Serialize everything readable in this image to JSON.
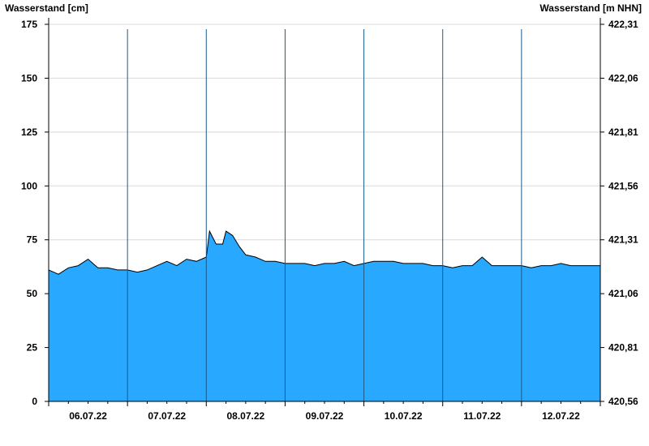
{
  "chart_data": {
    "type": "area",
    "ylabel_left": "Wasserstand [cm]",
    "ylabel_right": "Wasserstand [m NHN]",
    "ylim": [
      0,
      175
    ],
    "left_ticks": [
      "0",
      "25",
      "50",
      "75",
      "100",
      "125",
      "150",
      "175"
    ],
    "right_ticks": [
      "420,56",
      "420,81",
      "421,06",
      "421,31",
      "421,56",
      "421,81",
      "422,06",
      "422,31"
    ],
    "x_start": "06.07.22 00:00",
    "x_end": "13.07.22 00:00",
    "day_labels": [
      "06.07.22",
      "07.07.22",
      "08.07.22",
      "09.07.22",
      "10.07.22",
      "11.07.22",
      "12.07.22"
    ],
    "grid": true,
    "fill_color": "#29a8ff",
    "line_color": "#000000",
    "series": [
      {
        "x": [
          "06.07.22 00:00",
          "06.07.22 03:00",
          "06.07.22 06:00",
          "06.07.22 09:00",
          "06.07.22 12:00",
          "06.07.22 15:00",
          "06.07.22 18:00",
          "06.07.22 21:00",
          "07.07.22 00:00",
          "07.07.22 03:00",
          "07.07.22 06:00",
          "07.07.22 09:00",
          "07.07.22 12:00",
          "07.07.22 15:00",
          "07.07.22 18:00",
          "07.07.22 21:00",
          "08.07.22 00:00",
          "08.07.22 01:00",
          "08.07.22 03:00",
          "08.07.22 05:00",
          "08.07.22 06:00",
          "08.07.22 08:00",
          "08.07.22 10:00",
          "08.07.22 12:00",
          "08.07.22 15:00",
          "08.07.22 18:00",
          "08.07.22 21:00",
          "09.07.22 00:00",
          "09.07.22 03:00",
          "09.07.22 06:00",
          "09.07.22 09:00",
          "09.07.22 12:00",
          "09.07.22 15:00",
          "09.07.22 18:00",
          "09.07.22 21:00",
          "10.07.22 00:00",
          "10.07.22 03:00",
          "10.07.22 06:00",
          "10.07.22 09:00",
          "10.07.22 12:00",
          "10.07.22 15:00",
          "10.07.22 18:00",
          "10.07.22 21:00",
          "11.07.22 00:00",
          "11.07.22 03:00",
          "11.07.22 06:00",
          "11.07.22 09:00",
          "11.07.22 12:00",
          "11.07.22 15:00",
          "11.07.22 18:00",
          "11.07.22 21:00",
          "12.07.22 00:00",
          "12.07.22 03:00",
          "12.07.22 06:00",
          "12.07.22 09:00",
          "12.07.22 12:00",
          "12.07.22 15:00",
          "12.07.22 18:00",
          "12.07.22 21:00",
          "13.07.22 00:00"
        ],
        "values": [
          61,
          59,
          62,
          63,
          66,
          62,
          62,
          61,
          61,
          60,
          61,
          63,
          65,
          63,
          66,
          65,
          67,
          79,
          73,
          73,
          79,
          77,
          72,
          68,
          67,
          65,
          65,
          64,
          64,
          64,
          63,
          64,
          64,
          65,
          63,
          64,
          65,
          65,
          65,
          64,
          64,
          64,
          63,
          63,
          62,
          63,
          63,
          67,
          63,
          63,
          63,
          63,
          62,
          63,
          63,
          64,
          63,
          63,
          63,
          63
        ]
      }
    ]
  }
}
